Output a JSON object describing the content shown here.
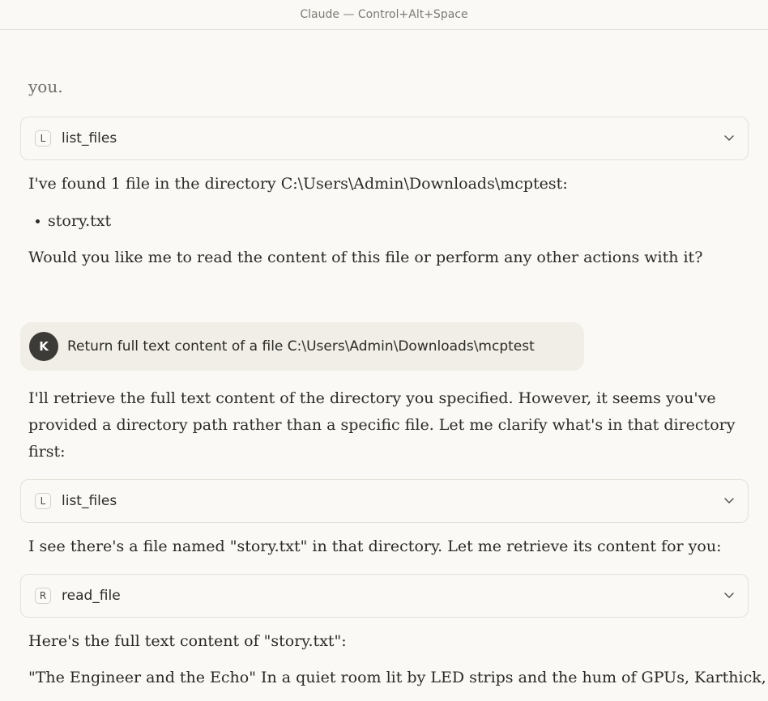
{
  "window": {
    "title": "Claude — Control+Alt+Space"
  },
  "chat": {
    "fade_text": "you.",
    "tool_call_1": {
      "letter": "L",
      "name": "list_files"
    },
    "msg_found": "I've found 1 file in the directory C:\\Users\\Admin\\Downloads\\mcptest:",
    "file_item": "story.txt",
    "msg_ask": "Would you like me to read the content of this file or perform any other actions with it?",
    "user": {
      "avatar_initial": "K",
      "message": "Return full text content of a file C:\\Users\\Admin\\Downloads\\mcptest"
    },
    "msg_retrieve_line1": "I'll retrieve the full text content of the directory you specified. However, it seems you've",
    "msg_retrieve_line2": "provided a directory path rather than a specific file. Let me clarify what's in that directory",
    "msg_retrieve_line3": "first:",
    "tool_call_2": {
      "letter": "L",
      "name": "list_files"
    },
    "msg_see": "I see there's a file named \"story.txt\" in that directory. Let me retrieve its content for you:",
    "tool_call_3": {
      "letter": "R",
      "name": "read_file"
    },
    "msg_here": "Here's the full text content of \"story.txt\":",
    "msg_story": "\"The Engineer and the Echo\" In a quiet room lit by LED strips and the hum of GPUs, Karthick,"
  },
  "icons": {
    "chevron": "chevron-down-icon"
  }
}
